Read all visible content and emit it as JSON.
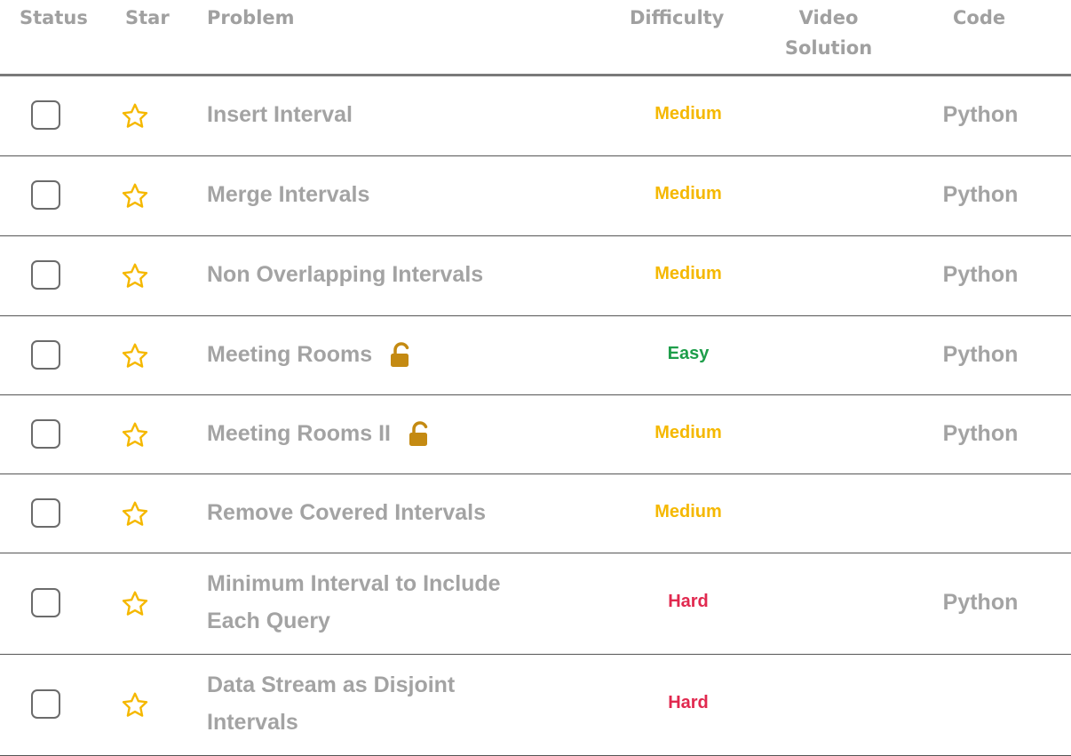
{
  "header": {
    "status": "Status",
    "star": "Star",
    "problem": "Problem",
    "difficulty": "Difficulty",
    "video_line1": "Video",
    "video_line2": "Solution",
    "code": "Code"
  },
  "colors": {
    "medium": "#f5b800",
    "easy": "#1e9e4a",
    "hard": "#e1294f",
    "star": "#f5b800",
    "lock": "#c48a12"
  },
  "problems": [
    {
      "name_lines": [
        "Insert Interval"
      ],
      "locked": false,
      "difficulty": "Medium",
      "difficulty_level": "medium",
      "code": "Python"
    },
    {
      "name_lines": [
        "Merge Intervals"
      ],
      "locked": false,
      "difficulty": "Medium",
      "difficulty_level": "medium",
      "code": "Python"
    },
    {
      "name_lines": [
        "Non Overlapping Intervals"
      ],
      "locked": false,
      "difficulty": "Medium",
      "difficulty_level": "medium",
      "code": "Python"
    },
    {
      "name_lines": [
        "Meeting Rooms"
      ],
      "locked": true,
      "difficulty": "Easy",
      "difficulty_level": "easy",
      "code": "Python"
    },
    {
      "name_lines": [
        "Meeting Rooms II"
      ],
      "locked": true,
      "difficulty": "Medium",
      "difficulty_level": "medium",
      "code": "Python"
    },
    {
      "name_lines": [
        "Remove Covered Intervals"
      ],
      "locked": false,
      "difficulty": "Medium",
      "difficulty_level": "medium",
      "code": ""
    },
    {
      "name_lines": [
        "Minimum Interval to Include",
        "Each Query"
      ],
      "locked": false,
      "difficulty": "Hard",
      "difficulty_level": "hard",
      "code": "Python"
    },
    {
      "name_lines": [
        "Data Stream as Disjoint",
        "Intervals"
      ],
      "locked": false,
      "difficulty": "Hard",
      "difficulty_level": "hard",
      "code": ""
    }
  ]
}
